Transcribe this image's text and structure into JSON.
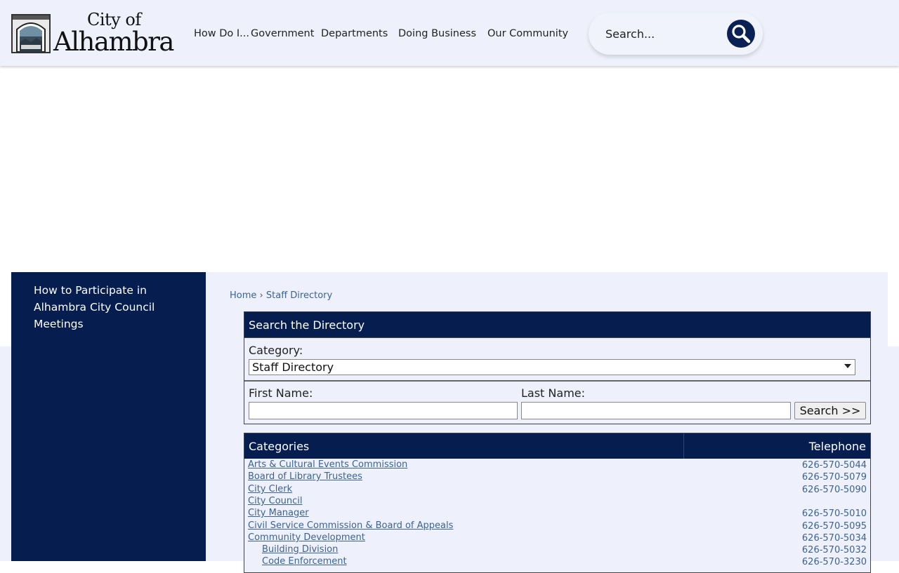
{
  "header": {
    "logo": {
      "line1": "City of",
      "line2": "Alhambra"
    },
    "nav": [
      {
        "label": "How Do I..."
      },
      {
        "label": "Government"
      },
      {
        "label": "Departments"
      },
      {
        "label": "Doing Business"
      },
      {
        "label": "Our Community"
      }
    ],
    "search": {
      "placeholder": "Search..."
    }
  },
  "sidebar": {
    "link": "How to Participate in Alhambra City Council Meetings"
  },
  "breadcrumb": {
    "home": "Home",
    "separator": "›",
    "current": "Staff Directory"
  },
  "directory_search": {
    "title": "Search the Directory",
    "category_label": "Category:",
    "category_value": "Staff Directory",
    "first_name_label": "First Name:",
    "last_name_label": "Last Name:",
    "button": "Search >>"
  },
  "categories": {
    "col_category": "Categories",
    "col_phone": "Telephone",
    "rows": [
      {
        "name": "Arts & Cultural Events Commission",
        "phone": "626-570-5044"
      },
      {
        "name": "Board of Library Trustees",
        "phone": "626-570-5079"
      },
      {
        "name": "City Clerk",
        "phone": "626-570-5090"
      },
      {
        "name": "City Council",
        "phone": ""
      },
      {
        "name": "City Manager",
        "phone": "626-570-5010"
      },
      {
        "name": "Civil Service Commission & Board of Appeals",
        "phone": "626-570-5095"
      },
      {
        "name": "Community Development",
        "phone": "626-570-5034"
      },
      {
        "name": "Building Division",
        "phone": "626-570-5032"
      },
      {
        "name": "Code Enforcement",
        "phone": "626-570-3230"
      }
    ]
  },
  "colors": {
    "navy": "#051d4f",
    "search_button": "#0a2156",
    "link": "#3b6392",
    "light_bg": "#eef1fb"
  }
}
